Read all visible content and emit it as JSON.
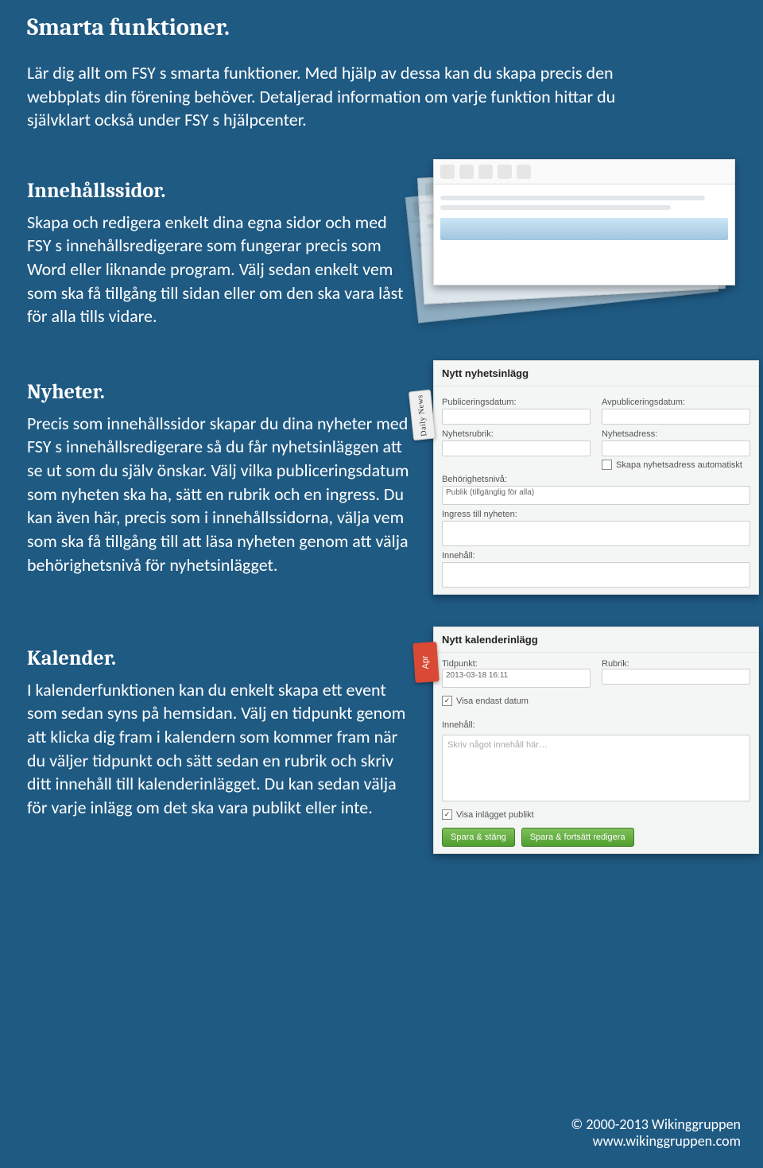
{
  "intro": {
    "title": "Smarta funktioner.",
    "text": "Lär dig allt om FSY s smarta funktioner. Med hjälp av dessa kan du skapa precis den webbplats din förening behöver. Detaljerad information om varje funktion hittar du självklart också under FSY s hjälpcenter."
  },
  "sections": {
    "innehall": {
      "title": "Innehållssidor.",
      "text": "Skapa och redigera enkelt dina egna sidor och med FSY s innehållsredigerare som fungerar precis som Word eller liknande program. Välj sedan enkelt vem som ska få tillgång till sidan eller om den ska vara låst för alla tills vidare."
    },
    "nyheter": {
      "title": "Nyheter.",
      "text": "Precis som innehållssidor skapar du dina nyheter med FSY s innehållsredigerare så du får nyhetsinläggen att se ut som du själv önskar. Välj vilka publiceringsdatum som nyheten ska ha, sätt en rubrik och en ingress. Du kan även här, precis som i innehållssidorna, välja vem som ska få tillgång till att läsa nyheten genom att välja behörighetsnivå för nyhetsinlägget."
    },
    "kalender": {
      "title": "Kalender.",
      "text": "I kalenderfunktionen kan du enkelt skapa ett event som sedan syns på hemsidan. Välj en tidpunkt genom att klicka dig fram i kalendern som kommer fram när du väljer tidpunkt och sätt sedan en rubrik och skriv ditt innehåll till kalenderinlägget. Du kan sedan välja för varje inlägg om det ska vara publikt eller inte."
    }
  },
  "screens": {
    "nyheter": {
      "heading": "Nytt nyhetsinlägg",
      "pubdate_label": "Publiceringsdatum:",
      "avpub_label": "Avpubliceringsdatum:",
      "rubrik_label": "Nyhetsrubrik:",
      "adress_label": "Nyhetsadress:",
      "adress_note": "Skapa nyhetsadress automatiskt",
      "beh_label": "Behörighetsnivå:",
      "beh_val": "Publik (tillgänglig för alla)",
      "ingress_label": "Ingress till nyheten:",
      "innehall_label": "Innehåll:",
      "badge": "Daily News"
    },
    "kalender": {
      "heading": "Nytt kalenderinlägg",
      "tid_label": "Tidpunkt:",
      "tid_val": "2013-03-18 16:11",
      "endast": "Visa endast datum",
      "rubrik_label": "Rubrik:",
      "innehall_label": "Innehåll:",
      "editor_placeholder": "Skriv något innehåll här…",
      "publik_label": "Visa inlägget publikt",
      "btn_save": "Spara & stäng",
      "btn_continue": "Spara & fortsätt redigera",
      "month_badge": "Apr"
    }
  },
  "footer": {
    "copyright": "© 2000-2013 Wikinggruppen",
    "url": "www.wikinggruppen.com"
  }
}
